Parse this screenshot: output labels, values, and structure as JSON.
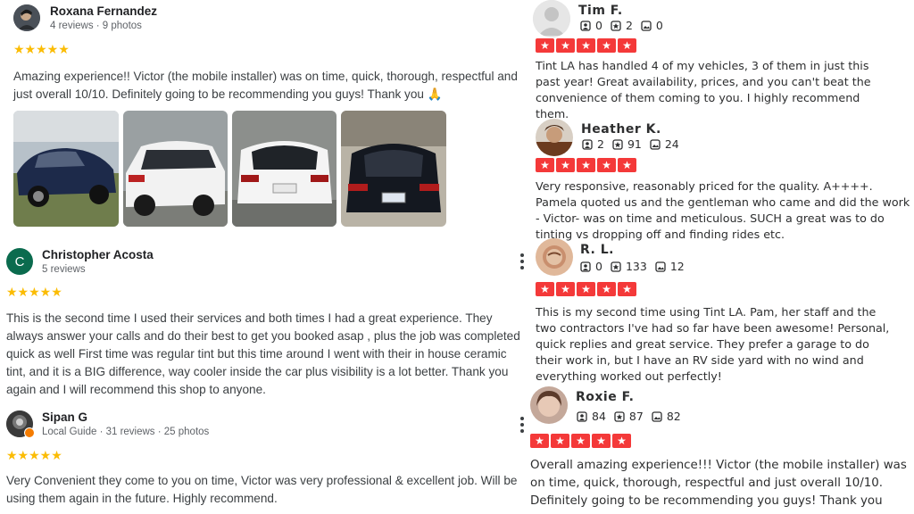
{
  "google": {
    "reviews": [
      {
        "name": "Roxana Fernandez",
        "meta": "4 reviews · 9 photos",
        "stars": "★★★★★",
        "text": "Amazing experience!! Victor (the mobile installer) was on time, quick, thorough, respectful and just overall 10/10. Definitely going to be recommending you guys! Thank you 🙏"
      },
      {
        "name": "Christopher Acosta",
        "avatar_letter": "C",
        "meta": "5 reviews",
        "stars": "★★★★★",
        "text": "This is the second time I used their services and both times I had a great experience. They always answer your calls and do their best to get you booked asap , plus the job was completed quick as well First time was regular tint but this time around I went with their in house ceramic tint, and it is a BIG difference, way cooler inside the car plus visibility is a lot better. Thank you again and I will recommend this shop to anyone."
      },
      {
        "name": "Sipan G",
        "meta": "Local Guide · 31 reviews · 25 photos",
        "stars": "★★★★★",
        "text": "Very Convenient they come to you on time, Victor was very professional & excellent job. Will be using them again in the future. Highly recommend."
      }
    ]
  },
  "yelp": {
    "reviews": [
      {
        "name": "Tim F.",
        "friends": "0",
        "reviews": "2",
        "photos": "0",
        "text": "Tint LA has handled 4 of my vehicles, 3 of them in just this past year! Great availability, prices, and you can't beat the convenience of them coming to you. I highly recommend them."
      },
      {
        "name": "Heather K.",
        "friends": "2",
        "reviews": "91",
        "photos": "24",
        "text": "Very responsive, reasonably priced for the quality. A++++. Pamela quoted us and the gentleman who came and did the work - Victor- was on time and meticulous. SUCH a great was to do tinting vs dropping off and finding rides etc."
      },
      {
        "name": "R. L.",
        "friends": "0",
        "reviews": "133",
        "photos": "12",
        "text": "This is my second time using Tint LA. Pam, her staff and the two contractors I've had so far have been awesome! Personal, quick replies and great service. They prefer a garage to do their work in, but I have an RV side yard with no wind and everything worked out perfectly!"
      },
      {
        "name": "Roxie F.",
        "friends": "84",
        "reviews": "87",
        "photos": "82",
        "text": "Overall amazing experience!!! Victor (the mobile installer) was on time, quick, thorough, respectful and just overall 10/10. Definitely going to be recommending you guys! Thank you"
      }
    ],
    "star_glyph": "★",
    "star_color": "#f43939"
  },
  "colors": {
    "google_star": "#fbbc04",
    "avatar_green": "#0b6b4e",
    "divider": "#e8eaed"
  }
}
